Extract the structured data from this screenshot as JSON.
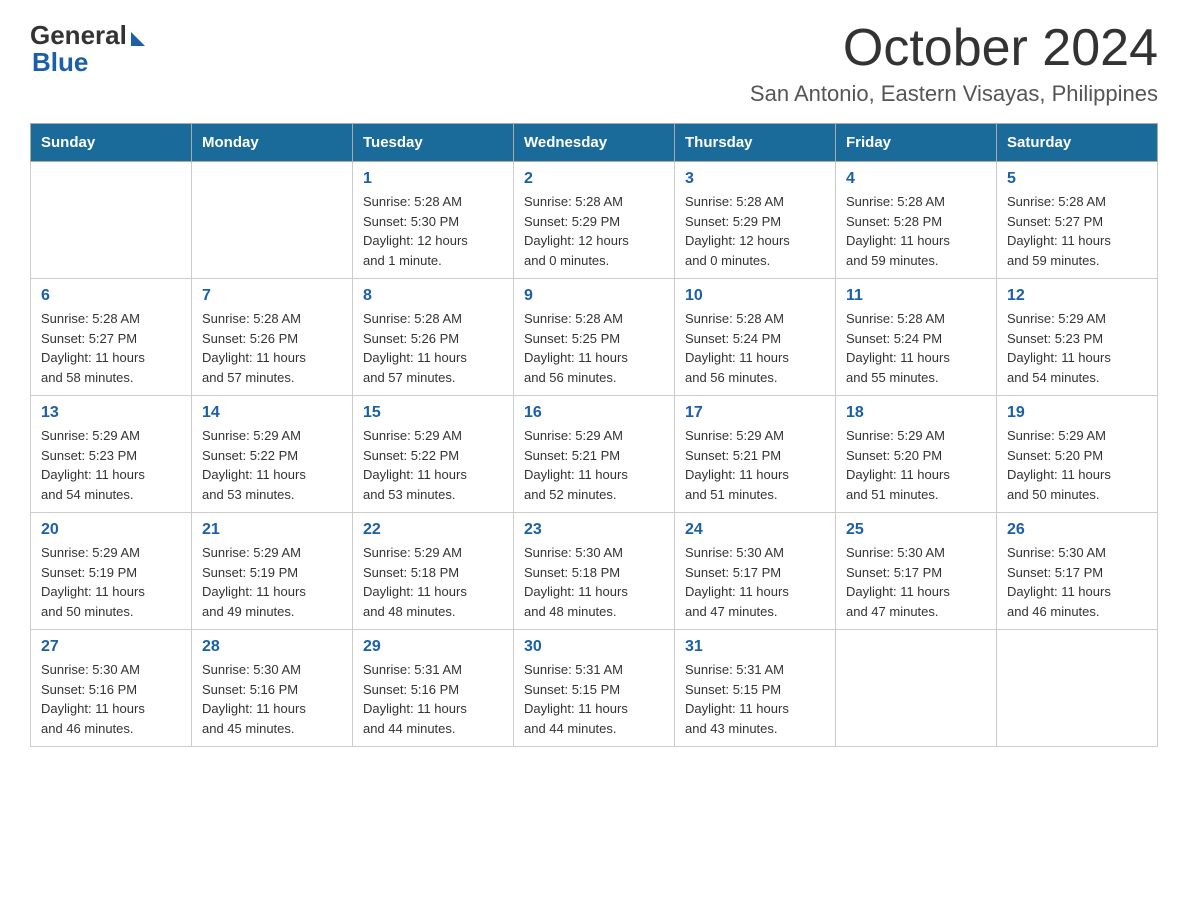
{
  "logo": {
    "general": "General",
    "blue": "Blue"
  },
  "header": {
    "title": "October 2024",
    "subtitle": "San Antonio, Eastern Visayas, Philippines"
  },
  "columns": [
    "Sunday",
    "Monday",
    "Tuesday",
    "Wednesday",
    "Thursday",
    "Friday",
    "Saturday"
  ],
  "weeks": [
    [
      {
        "day": "",
        "info": ""
      },
      {
        "day": "",
        "info": ""
      },
      {
        "day": "1",
        "info": "Sunrise: 5:28 AM\nSunset: 5:30 PM\nDaylight: 12 hours\nand 1 minute."
      },
      {
        "day": "2",
        "info": "Sunrise: 5:28 AM\nSunset: 5:29 PM\nDaylight: 12 hours\nand 0 minutes."
      },
      {
        "day": "3",
        "info": "Sunrise: 5:28 AM\nSunset: 5:29 PM\nDaylight: 12 hours\nand 0 minutes."
      },
      {
        "day": "4",
        "info": "Sunrise: 5:28 AM\nSunset: 5:28 PM\nDaylight: 11 hours\nand 59 minutes."
      },
      {
        "day": "5",
        "info": "Sunrise: 5:28 AM\nSunset: 5:27 PM\nDaylight: 11 hours\nand 59 minutes."
      }
    ],
    [
      {
        "day": "6",
        "info": "Sunrise: 5:28 AM\nSunset: 5:27 PM\nDaylight: 11 hours\nand 58 minutes."
      },
      {
        "day": "7",
        "info": "Sunrise: 5:28 AM\nSunset: 5:26 PM\nDaylight: 11 hours\nand 57 minutes."
      },
      {
        "day": "8",
        "info": "Sunrise: 5:28 AM\nSunset: 5:26 PM\nDaylight: 11 hours\nand 57 minutes."
      },
      {
        "day": "9",
        "info": "Sunrise: 5:28 AM\nSunset: 5:25 PM\nDaylight: 11 hours\nand 56 minutes."
      },
      {
        "day": "10",
        "info": "Sunrise: 5:28 AM\nSunset: 5:24 PM\nDaylight: 11 hours\nand 56 minutes."
      },
      {
        "day": "11",
        "info": "Sunrise: 5:28 AM\nSunset: 5:24 PM\nDaylight: 11 hours\nand 55 minutes."
      },
      {
        "day": "12",
        "info": "Sunrise: 5:29 AM\nSunset: 5:23 PM\nDaylight: 11 hours\nand 54 minutes."
      }
    ],
    [
      {
        "day": "13",
        "info": "Sunrise: 5:29 AM\nSunset: 5:23 PM\nDaylight: 11 hours\nand 54 minutes."
      },
      {
        "day": "14",
        "info": "Sunrise: 5:29 AM\nSunset: 5:22 PM\nDaylight: 11 hours\nand 53 minutes."
      },
      {
        "day": "15",
        "info": "Sunrise: 5:29 AM\nSunset: 5:22 PM\nDaylight: 11 hours\nand 53 minutes."
      },
      {
        "day": "16",
        "info": "Sunrise: 5:29 AM\nSunset: 5:21 PM\nDaylight: 11 hours\nand 52 minutes."
      },
      {
        "day": "17",
        "info": "Sunrise: 5:29 AM\nSunset: 5:21 PM\nDaylight: 11 hours\nand 51 minutes."
      },
      {
        "day": "18",
        "info": "Sunrise: 5:29 AM\nSunset: 5:20 PM\nDaylight: 11 hours\nand 51 minutes."
      },
      {
        "day": "19",
        "info": "Sunrise: 5:29 AM\nSunset: 5:20 PM\nDaylight: 11 hours\nand 50 minutes."
      }
    ],
    [
      {
        "day": "20",
        "info": "Sunrise: 5:29 AM\nSunset: 5:19 PM\nDaylight: 11 hours\nand 50 minutes."
      },
      {
        "day": "21",
        "info": "Sunrise: 5:29 AM\nSunset: 5:19 PM\nDaylight: 11 hours\nand 49 minutes."
      },
      {
        "day": "22",
        "info": "Sunrise: 5:29 AM\nSunset: 5:18 PM\nDaylight: 11 hours\nand 48 minutes."
      },
      {
        "day": "23",
        "info": "Sunrise: 5:30 AM\nSunset: 5:18 PM\nDaylight: 11 hours\nand 48 minutes."
      },
      {
        "day": "24",
        "info": "Sunrise: 5:30 AM\nSunset: 5:17 PM\nDaylight: 11 hours\nand 47 minutes."
      },
      {
        "day": "25",
        "info": "Sunrise: 5:30 AM\nSunset: 5:17 PM\nDaylight: 11 hours\nand 47 minutes."
      },
      {
        "day": "26",
        "info": "Sunrise: 5:30 AM\nSunset: 5:17 PM\nDaylight: 11 hours\nand 46 minutes."
      }
    ],
    [
      {
        "day": "27",
        "info": "Sunrise: 5:30 AM\nSunset: 5:16 PM\nDaylight: 11 hours\nand 46 minutes."
      },
      {
        "day": "28",
        "info": "Sunrise: 5:30 AM\nSunset: 5:16 PM\nDaylight: 11 hours\nand 45 minutes."
      },
      {
        "day": "29",
        "info": "Sunrise: 5:31 AM\nSunset: 5:16 PM\nDaylight: 11 hours\nand 44 minutes."
      },
      {
        "day": "30",
        "info": "Sunrise: 5:31 AM\nSunset: 5:15 PM\nDaylight: 11 hours\nand 44 minutes."
      },
      {
        "day": "31",
        "info": "Sunrise: 5:31 AM\nSunset: 5:15 PM\nDaylight: 11 hours\nand 43 minutes."
      },
      {
        "day": "",
        "info": ""
      },
      {
        "day": "",
        "info": ""
      }
    ]
  ]
}
